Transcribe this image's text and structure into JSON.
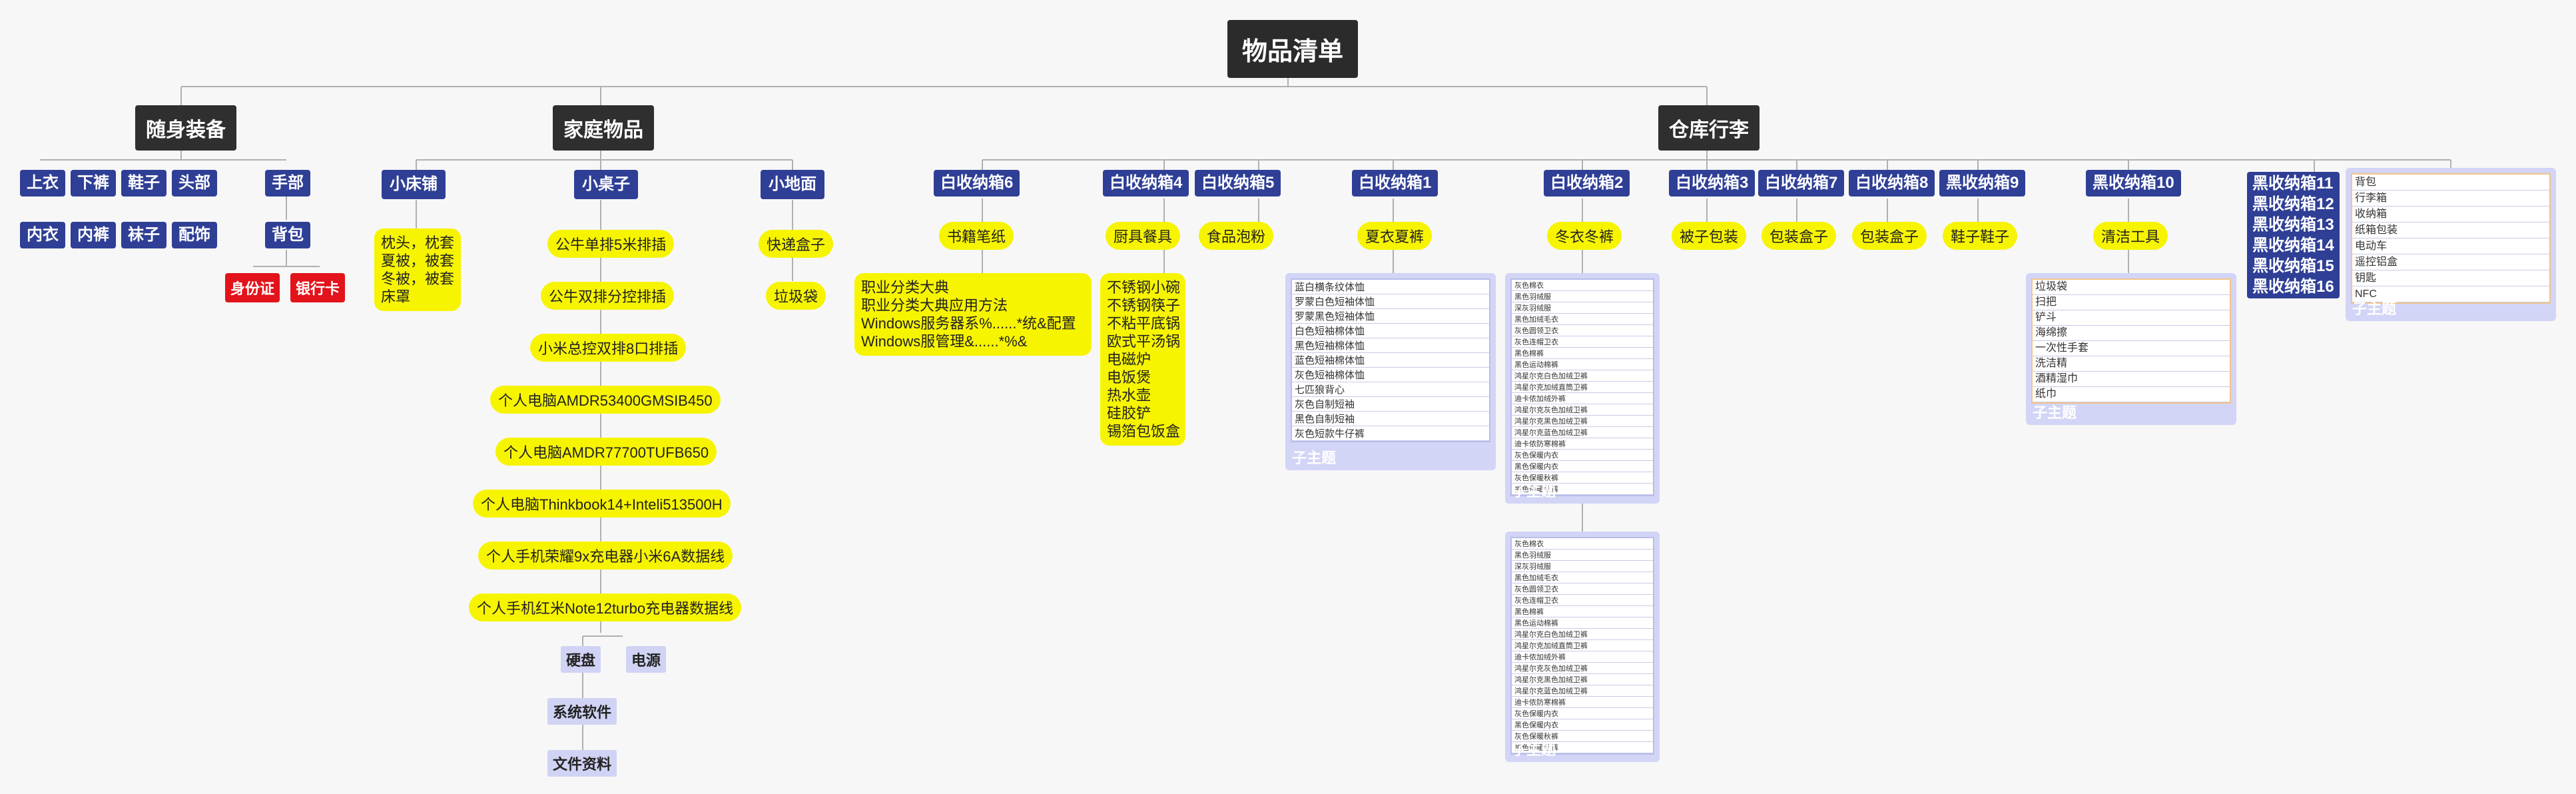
{
  "root": "物品清单",
  "branches": {
    "carry": "随身装备",
    "home": "家庭物品",
    "warehouse": "仓库行李"
  },
  "carry": {
    "items": [
      "上衣",
      "下裤",
      "鞋子",
      "头部",
      "手部",
      "内衣",
      "内裤",
      "袜子",
      "配饰",
      "背包"
    ],
    "red": [
      "身份证",
      "银行卡"
    ]
  },
  "home": {
    "bed": {
      "label": "小床铺",
      "content": [
        "枕头，枕套",
        "夏被，被套",
        "冬被，被套",
        "床罩"
      ]
    },
    "desk": {
      "label": "小桌子",
      "items": [
        "公牛单排5米排插",
        "公牛双排分控排插",
        "小米总控双排8口排插",
        "个人电脑AMDR53400GMSIB450",
        "个人电脑AMDR77700TUFB650",
        "个人电脑Thinkbook14+Inteli513500H",
        "个人手机荣耀9x充电器小米6A数据线",
        "个人手机红米Note12turbo充电器数据线"
      ],
      "sub": [
        "硬盘",
        "电源",
        "系统软件",
        "文件资料"
      ]
    },
    "floor": {
      "label": "小地面",
      "items": [
        "快递盒子",
        "垃圾袋"
      ]
    }
  },
  "warehouse": {
    "b6": {
      "label": "白收纳箱6",
      "tag": "书籍笔纸",
      "content": [
        "职业分类大典",
        "职业分类大典应用方法",
        "Windows服务器系%......*统&配置",
        "Windows服管理&......*%&"
      ]
    },
    "b4": {
      "label": "白收纳箱4",
      "tag": "厨具餐具",
      "content": [
        "不锈钢小碗",
        "不锈钢筷子",
        "不粘平底锅",
        "欧式平汤锅",
        "电磁炉",
        "电饭煲",
        "热水壶",
        "硅胶铲",
        "锡箔包饭盒"
      ]
    },
    "b5": {
      "label": "白收纳箱5",
      "tag": "食品泡粉"
    },
    "b1": {
      "label": "白收纳箱1",
      "tag": "夏衣夏裤",
      "list": [
        "蓝白横条纹体恤",
        "罗蒙白色短袖体恤",
        "罗蒙黑色短袖体恤",
        "白色短袖棉体恤",
        "黑色短袖棉体恤",
        "蓝色短袖棉体恤",
        "灰色短袖棉体恤",
        "七匹狼背心",
        "灰色自制短袖",
        "黑色自制短袖",
        "灰色短款牛仔裤"
      ],
      "foot": "子主题"
    },
    "b2": {
      "label": "白收纳箱2",
      "tag": "冬衣冬裤",
      "list": [
        "灰色棉衣",
        "黑色羽绒服",
        "深灰羽绒服",
        "黑色加绒毛衣",
        "灰色圆领卫衣",
        "灰色连帽卫衣",
        "黑色棉裤",
        "黑色运动棉裤",
        "鸿星尔克白色加绒卫裤",
        "鸿星尔克加绒直筒卫裤",
        "迪卡侬加绒外裤",
        "鸿星尔克灰色加绒卫裤",
        "鸿星尔克黑色加绒卫裤",
        "鸿星尔克蓝色加绒卫裤",
        "迪卡侬防寒棉裤",
        "灰色保暖内衣",
        "黑色保暖内衣",
        "灰色保暖秋裤",
        "黑色保暖秋裤"
      ],
      "foot": "子主题",
      "foot2": "子主题"
    },
    "b3": {
      "label": "白收纳箱3",
      "tag": "被子包装"
    },
    "b7": {
      "label": "白收纳箱7",
      "tag": "包装盒子"
    },
    "b8": {
      "label": "白收纳箱8",
      "tag": "包装盒子"
    },
    "k9": {
      "label": "黑收纳箱9",
      "tag": "鞋子鞋子"
    },
    "k10": {
      "label": "黑收纳箱10",
      "tag": "清洁工具",
      "list": [
        "垃圾袋",
        "扫把",
        "铲斗",
        "海绵擦",
        "一次性手套",
        "洗洁精",
        "酒精湿巾",
        "纸巾"
      ],
      "foot": "子主题"
    },
    "k11_16": [
      "黑收纳箱11",
      "黑收纳箱12",
      "黑收纳箱13",
      "黑收纳箱14",
      "黑收纳箱15",
      "黑收纳箱16"
    ],
    "misc": {
      "list": [
        "背包",
        "行李箱",
        "收纳箱",
        "纸箱包装",
        "电动车",
        "遥控铝盒",
        "钥匙",
        "NFC"
      ],
      "foot": "子主题"
    }
  },
  "colors": {
    "dark": "#2b2b2b",
    "blue": "#2f3f96",
    "yellow": "#f7f400",
    "red": "#e3131b",
    "lavender": "#d0d3f3"
  }
}
